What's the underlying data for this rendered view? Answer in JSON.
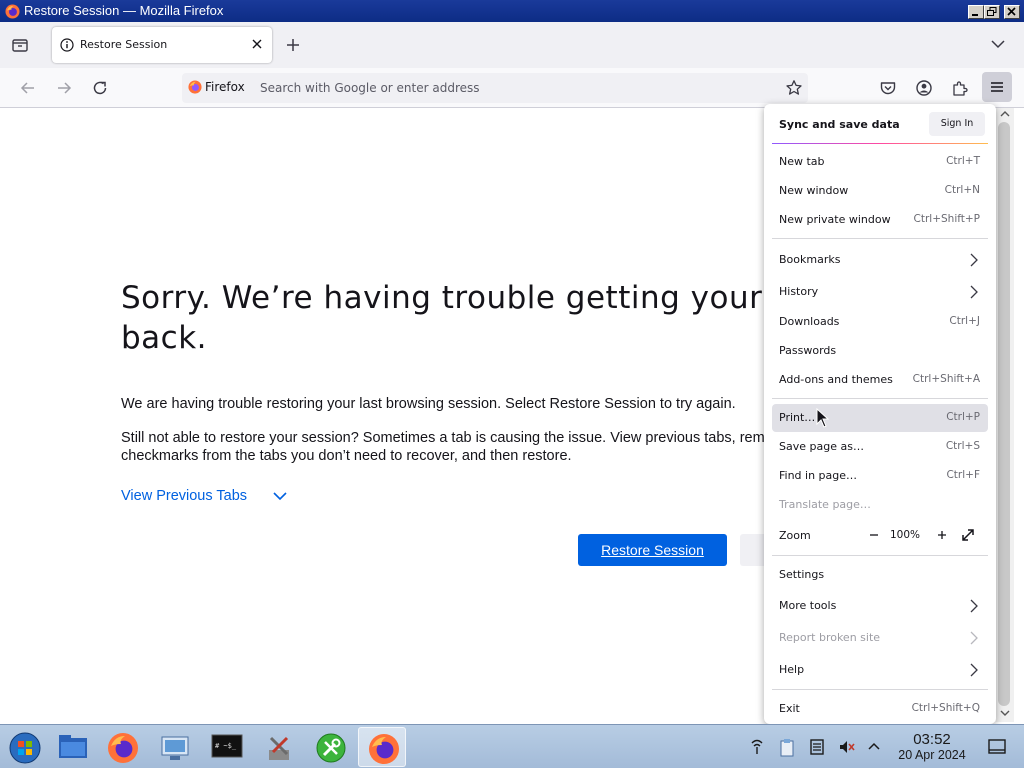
{
  "window": {
    "title": "Restore Session — Mozilla Firefox"
  },
  "tabs": [
    {
      "title": "Restore Session"
    }
  ],
  "urlbar": {
    "identity_label": "Firefox",
    "placeholder": "Search with Google or enter address"
  },
  "page": {
    "heading": "Sorry. We’re having trouble getting your pages back.",
    "para1": "We are having trouble restoring your last browsing session. Select Restore Session to try again.",
    "para2": "Still not able to restore your session? Sometimes a tab is causing the issue. View previous tabs, remove checkmarks from the tabs you don’t need to recover, and then restore.",
    "view_previous_tabs": "View Previous Tabs",
    "restore_button": "Restore Session"
  },
  "app_menu": {
    "sync_label": "Sync and save data",
    "sign_in": "Sign In",
    "items": {
      "new_tab": {
        "label": "New tab",
        "shortcut": "Ctrl+T"
      },
      "new_window": {
        "label": "New window",
        "shortcut": "Ctrl+N"
      },
      "new_private_window": {
        "label": "New private window",
        "shortcut": "Ctrl+Shift+P"
      },
      "bookmarks": {
        "label": "Bookmarks"
      },
      "history": {
        "label": "History"
      },
      "downloads": {
        "label": "Downloads",
        "shortcut": "Ctrl+J"
      },
      "passwords": {
        "label": "Passwords"
      },
      "addons": {
        "label": "Add-ons and themes",
        "shortcut": "Ctrl+Shift+A"
      },
      "print": {
        "label": "Print…",
        "shortcut": "Ctrl+P"
      },
      "save_page": {
        "label": "Save page as…",
        "shortcut": "Ctrl+S"
      },
      "find": {
        "label": "Find in page…",
        "shortcut": "Ctrl+F"
      },
      "translate": {
        "label": "Translate page…"
      },
      "zoom": {
        "label": "Zoom",
        "value": "100%"
      },
      "settings": {
        "label": "Settings"
      },
      "more_tools": {
        "label": "More tools"
      },
      "report": {
        "label": "Report broken site"
      },
      "help": {
        "label": "Help"
      },
      "exit": {
        "label": "Exit",
        "shortcut": "Ctrl+Shift+Q"
      }
    }
  },
  "taskbar": {
    "clock": {
      "time": "03:52",
      "date": "20 Apr 2024"
    },
    "terminal_label": "#  ~$_"
  },
  "colors": {
    "accent": "#0061e0",
    "titlebar": "#0d2c85",
    "menu_highlight": "#e0e0e6"
  }
}
